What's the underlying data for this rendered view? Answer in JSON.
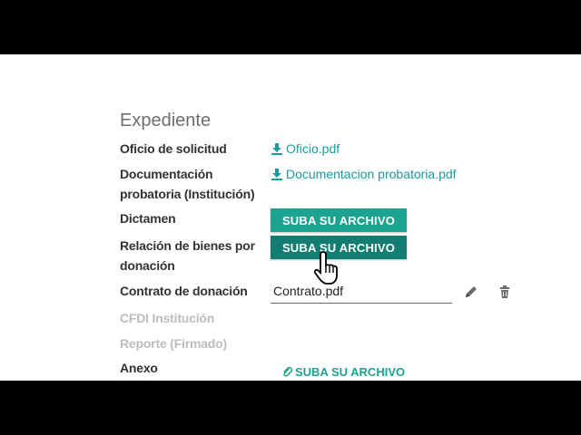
{
  "section": {
    "title": "Expediente"
  },
  "rows": [
    {
      "label": "Oficio de solicitud",
      "file": "Oficio.pdf"
    },
    {
      "label": "Documentación probatoria (Institución)",
      "file": "Documentacion probatoria.pdf"
    },
    {
      "label": "Dictamen",
      "button": "SUBA SU ARCHIVO"
    },
    {
      "label": "Relación de bienes por donación",
      "button": "SUBA SU ARCHIVO"
    },
    {
      "label": "Contrato de donación",
      "file": "Contrato.pdf"
    },
    {
      "label": "CFDI Institución"
    },
    {
      "label": "Reporte (Firmado)"
    },
    {
      "label": "Anexo",
      "button": "SUBA SU ARCHIVO"
    }
  ],
  "colors": {
    "accent": "#1aa38f",
    "accent_hover": "#127d70",
    "link": "#1b9aa0"
  },
  "icons": [
    "download-icon",
    "pencil-icon",
    "trash-icon",
    "paperclip-icon",
    "hand-pointer-cursor"
  ]
}
